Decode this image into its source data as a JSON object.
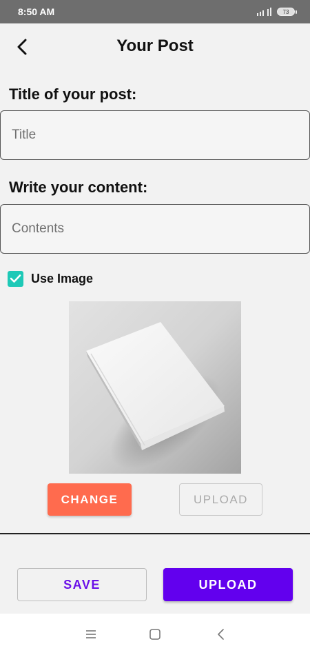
{
  "status_bar": {
    "time": "8:50 AM",
    "battery": "73",
    "signal_icon": "signal-icon",
    "battery_icon": "battery-icon"
  },
  "header": {
    "title": "Your Post",
    "back_icon": "chevron-left-icon"
  },
  "form": {
    "title_label": "Title of your post:",
    "title_placeholder": "Title",
    "title_value": "",
    "content_label": "Write your content:",
    "content_placeholder": "Contents",
    "content_value": "",
    "use_image_label": "Use Image",
    "use_image_checked": true
  },
  "image_actions": {
    "change_label": "CHANGE",
    "upload_label": "UPLOAD"
  },
  "footer_actions": {
    "save_label": "SAVE",
    "upload_label": "UPLOAD"
  },
  "nav_bar": {
    "menu_icon": "menu-icon",
    "home_icon": "square-home-icon",
    "back_icon": "triangle-back-icon"
  },
  "colors": {
    "accent_orange": "#ff6b4e",
    "accent_purple": "#6200ee",
    "checkbox_teal": "#1ec9b7"
  }
}
